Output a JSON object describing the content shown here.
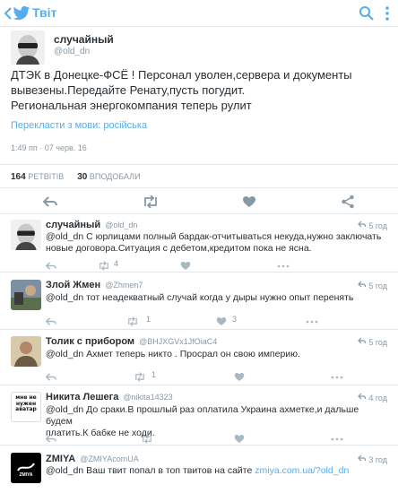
{
  "appbar": {
    "title": "Твіт",
    "icons": [
      "back-arrow-icon",
      "twitter-bird-icon",
      "search-icon",
      "more-vertical-icon"
    ],
    "accent": "#55acee"
  },
  "tweet": {
    "name": "случайный",
    "handle": "@old_dn",
    "text_lines": [
      "ДТЭК в Донецке-ФСЁ ! Персонал уволен,сервера и документы",
      "вывезены.Передайте Ренату,пусть погудит.",
      "Региональная энергокомпания теперь рулит"
    ],
    "translate": "Перекласти з мови: російська",
    "timestamp": "1:49 пп · 07 черв. 16",
    "retweets_count": "164",
    "retweets_label": "РЕТВІТІВ",
    "likes_count": "30",
    "likes_label": "ВПОДОБАЛИ",
    "actions": [
      "reply-icon",
      "retweet-icon",
      "like-icon",
      "share-icon"
    ]
  },
  "replies": [
    {
      "name": "случайный",
      "handle": "@old_dn",
      "time": "5 год",
      "text_lines": [
        "@old_dn С юрлицами полный бардак-отчитываться некуда,нужно заключать",
        "новые договора.Ситуация с дебетом,кредитом пока не ясна."
      ],
      "retweets": "4",
      "likes": ""
    },
    {
      "name": "Злой Жмен",
      "handle": "@Zhmen7",
      "time": "5 год",
      "text_lines": [
        "@old_dn тот неадекватный случай когда у дыры нужно опыт перенять"
      ],
      "retweets": "1",
      "likes": "3"
    },
    {
      "name": "Толик с прибором",
      "handle": "@BHJXGVx1JfOiaC4",
      "time": "5 год",
      "text_lines": [
        "@old_dn Ахмет теперь никто . Просрал он свою империю."
      ],
      "retweets": "1",
      "likes": ""
    },
    {
      "name": "Никита Лешега",
      "handle": "@nikita14323",
      "time": "4 год",
      "text_lines": [
        "@old_dn До сраки.В прошлый раз оплатила Украина ахметке,и дальше будем",
        "платить.К бабке не ходи."
      ],
      "retweets": "",
      "likes": "",
      "avatar_text": "мне не нужен аватар"
    },
    {
      "name": "ZMIYA",
      "handle": "@ZMIYAcomUA",
      "time": "3 год",
      "text_prefix": "@old_dn Ваш твит попал в топ твитов на сайте ",
      "link": "zmiya.com.ua/?old_dn",
      "avatar_text": "ZMIYA"
    }
  ]
}
